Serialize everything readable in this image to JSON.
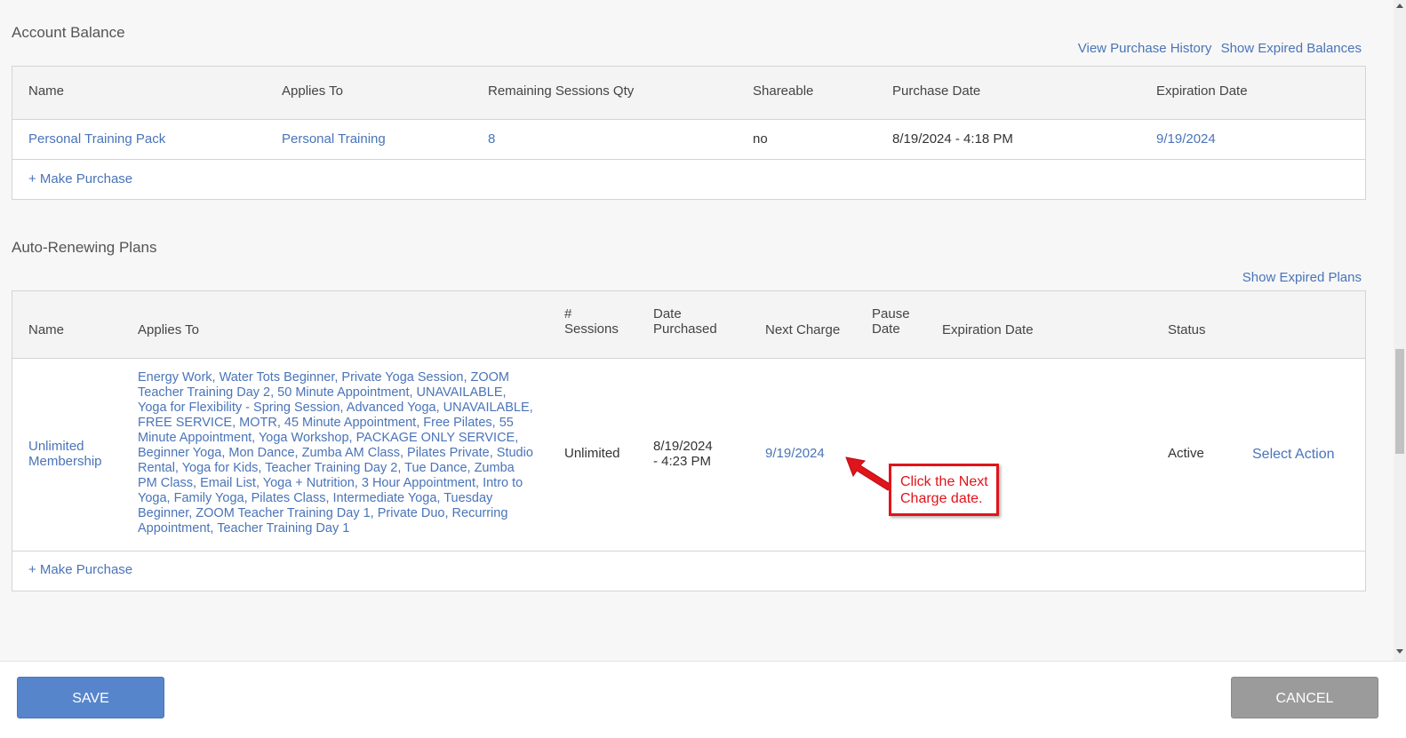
{
  "account_balance": {
    "title": "Account Balance",
    "links": {
      "history": "View Purchase History",
      "expired": "Show Expired Balances"
    },
    "columns": [
      "Name",
      "Applies To",
      "Remaining Sessions Qty",
      "Shareable",
      "Purchase Date",
      "Expiration Date"
    ],
    "row": {
      "name": "Personal Training Pack",
      "applies_to": "Personal Training",
      "remaining": "8",
      "shareable": "no",
      "purchase_date": "8/19/2024 - 4:18 PM",
      "expiration": "9/19/2024"
    },
    "make_purchase": "+ Make Purchase"
  },
  "plans": {
    "title": "Auto-Renewing Plans",
    "links": {
      "expired": "Show Expired Plans"
    },
    "columns": {
      "name": "Name",
      "applies_to": "Applies To",
      "sessions_1": "#",
      "sessions_2": "Sessions",
      "date_1": "Date",
      "date_2": "Purchased",
      "next_charge": "Next Charge",
      "pause_1": "Pause",
      "pause_2": "Date",
      "expiration": "Expiration Date",
      "status": "Status"
    },
    "row": {
      "name_1": "Unlimited",
      "name_2": "Membership",
      "applies_to": "Energy Work, Water Tots Beginner, Private Yoga Session, ZOOM Teacher Training Day 2, 50 Minute Appointment, UNAVAILABLE, Yoga for Flexibility - Spring Session, Advanced Yoga, UNAVAILABLE, FREE SERVICE, MOTR, 45 Minute Appointment, Free Pilates, 55 Minute Appointment, Yoga Workshop, PACKAGE ONLY SERVICE, Beginner Yoga, Mon Dance, Zumba AM Class, Pilates Private, Studio Rental, Yoga for Kids, Teacher Training Day 2, Tue Dance, Zumba PM Class, Email List, Yoga + Nutrition, 3 Hour Appointment, Intro to Yoga, Family Yoga, Pilates Class, Intermediate Yoga, Tuesday Beginner, ZOOM Teacher Training Day 1, Private Duo, Recurring Appointment, Teacher Training Day 1",
      "sessions": "Unlimited",
      "date_1": "8/19/2024",
      "date_2": "- 4:23 PM",
      "next_charge": "9/19/2024",
      "status": "Active",
      "action": "Select Action"
    },
    "make_purchase": "+ Make Purchase"
  },
  "callout": {
    "line1": "Click the Next",
    "line2": "Charge date."
  },
  "buttons": {
    "save": "SAVE",
    "cancel": "CANCEL"
  },
  "colors": {
    "link": "#4a74b8",
    "save": "#5785cb",
    "cancel": "#9b9b9b",
    "annotation": "#e0141b"
  }
}
